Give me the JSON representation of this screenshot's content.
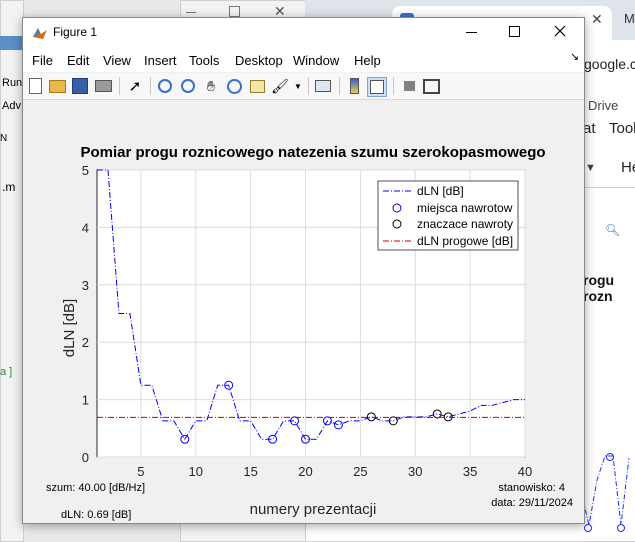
{
  "window": {
    "title": "Figure 1"
  },
  "menu": [
    "File",
    "Edit",
    "View",
    "Insert",
    "Tools",
    "Desktop",
    "Window",
    "Help"
  ],
  "toolbar": [
    "new-file-icon",
    "open-folder-icon",
    "save-icon",
    "print-icon",
    "pointer-icon",
    "zoom-in-icon",
    "zoom-out-icon",
    "pan-icon",
    "rotate-3d-icon",
    "data-cursor-icon",
    "brush-icon",
    "link-icon",
    "colorbar-icon",
    "legend-icon",
    "hide-plot-tools-icon",
    "show-plot-tools-icon"
  ],
  "background": {
    "left_items": [
      "Run",
      "Adv",
      "N",
      ".m",
      "a ]"
    ],
    "chrome_tab_fragment": "M",
    "url_fragment": "google.c",
    "drive_label": "Drive",
    "at_fragment": "at",
    "tools_fragment": "Tool",
    "he_fragment": "He",
    "title_fragment": "rogu rozn"
  },
  "chart_data": {
    "type": "line",
    "title": "Pomiar progu roznicowego natezenia szumu szerokopasmowego",
    "xlabel": "numery prezentacji",
    "ylabel": "dLN [dB]",
    "xlim": [
      1,
      40
    ],
    "ylim": [
      0,
      5
    ],
    "xticks": [
      5,
      10,
      15,
      20,
      25,
      30,
      35,
      40
    ],
    "yticks": [
      0,
      1,
      2,
      3,
      4,
      5
    ],
    "grid": true,
    "legend_position": "top-right",
    "series": [
      {
        "name": "dLN [dB]",
        "style": "dash-dot",
        "color": "#0000ff",
        "x": [
          1,
          2,
          3,
          4,
          5,
          6,
          7,
          8,
          9,
          10,
          11,
          12,
          13,
          14,
          15,
          16,
          17,
          18,
          19,
          20,
          21,
          22,
          23,
          24,
          25,
          26,
          27,
          28,
          29,
          30,
          31,
          32,
          33,
          34,
          35,
          36,
          37,
          38,
          39,
          40
        ],
        "y": [
          5,
          5,
          2.5,
          2.5,
          1.25,
          1.25,
          0.63,
          0.63,
          0.31,
          0.63,
          0.63,
          1.25,
          1.25,
          0.63,
          0.63,
          0.31,
          0.31,
          0.63,
          0.63,
          0.31,
          0.31,
          0.63,
          0.56,
          0.63,
          0.63,
          0.7,
          0.63,
          0.63,
          0.7,
          0.7,
          0.7,
          0.75,
          0.7,
          0.75,
          0.8,
          0.9,
          0.9,
          0.95,
          1.0,
          1.0
        ]
      },
      {
        "name": "miejsca nawrotow",
        "style": "circle",
        "color": "#0000ff",
        "x": [
          9,
          13,
          17,
          19,
          20,
          22,
          23
        ],
        "y": [
          0.31,
          1.25,
          0.31,
          0.63,
          0.31,
          0.63,
          0.56
        ]
      },
      {
        "name": "znaczace nawroty",
        "style": "circle",
        "color": "#000000",
        "x": [
          26,
          28,
          32,
          33
        ],
        "y": [
          0.7,
          0.63,
          0.75,
          0.7
        ]
      },
      {
        "name": "dLN progowe [dB]",
        "style": "dash-dot",
        "color": "#c00000",
        "x": [
          1,
          40
        ],
        "y": [
          0.69,
          0.69
        ]
      }
    ],
    "annotations": {
      "szum": "szum: 40.00 [dB/Hz]",
      "dln": "dLN: 0.69 [dB]",
      "stanowisko": "stanowisko: 4",
      "data": "data: 29/11/2024"
    }
  }
}
